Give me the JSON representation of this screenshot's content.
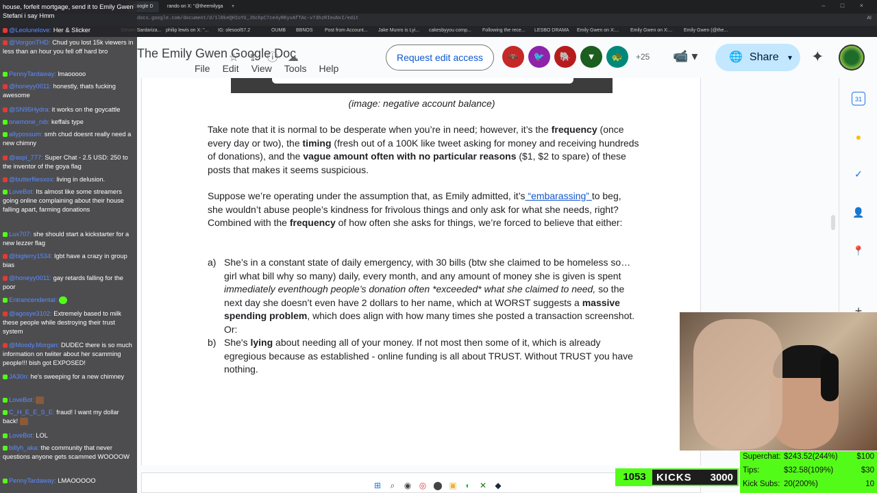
{
  "browser": {
    "tabs": [
      {
        "label": "Google D"
      },
      {
        "label": "rando on X: \"@theemilyga"
      },
      {
        "label": "+"
      }
    ],
    "url": "docs.google.com/document/d/1lRkeQHIoYU_J6chpC7ce4yRKyvAfTAc-v73hzRIeuNxI/edit",
    "address_right": "AI",
    "window_controls": "– □ ×",
    "bookmarks": [
      "Steven Sardariza...",
      "philip lewis on X: \"...",
      "IG: olesool57.2",
      "OUMB",
      "BBNOS",
      "Post from Account...",
      "Jake Munro is Lyi...",
      "cakesbyyou comp...",
      "Following the rece...",
      "LESBO DRAMA",
      "Emily Gwen on X:...",
      "Emily Gwen on X:...",
      "Emily Gwen (@the..."
    ]
  },
  "docs": {
    "title": "The Emily Gwen Google Doc",
    "icons": [
      "☆",
      "⇪",
      "ⓘ",
      "☁"
    ],
    "menu": [
      "File",
      "Edit",
      "View",
      "Tools",
      "Help"
    ],
    "request_access": "Request edit access",
    "avatars": [
      {
        "name": "bat-avatar-icon",
        "glyph": "🦇",
        "color": "#c62828"
      },
      {
        "name": "bird-avatar-icon",
        "glyph": "🐦",
        "color": "#8e24aa"
      },
      {
        "name": "elephant-avatar-icon",
        "glyph": "🐘",
        "color": "#b71c1c"
      },
      {
        "name": "narwhal-avatar-icon",
        "glyph": "▼",
        "color": "#1b5e20"
      },
      {
        "name": "turtle-avatar-icon",
        "glyph": "🐢",
        "color": "#00897b"
      }
    ],
    "avatar_count": "+25",
    "meet": "📹 ▾",
    "share": "Share",
    "share_globe": "🌐",
    "share_caret": "▾",
    "gemini": "✦"
  },
  "content": {
    "caption": "(image: negative account balance)",
    "p1": [
      {
        "t": "Take note that it is normal to be desperate when you’re in need; however, it’s the ",
        "s": ""
      },
      {
        "t": "frequency",
        "s": "b"
      },
      {
        "t": " (once every day or two), the ",
        "s": ""
      },
      {
        "t": "timing",
        "s": "b"
      },
      {
        "t": " (fresh out of a 100K like tweet asking for money and receiving hundreds of donations), and the ",
        "s": ""
      },
      {
        "t": "vague amount often with no particular reasons",
        "s": "b"
      },
      {
        "t": " ($1, $2 to spare) of these posts that makes it seems suspicious.",
        "s": ""
      }
    ],
    "p2": [
      {
        "t": "Suppose we’re operating under the assumption that, as Emily admitted, it’s",
        "s": ""
      },
      {
        "t": " “embarassing” ",
        "s": "link"
      },
      {
        "t": "to beg, she wouldn’t abuse people’s kindness for frivolous things and only ask for what she needs, right? Combined with the ",
        "s": ""
      },
      {
        "t": "frequency",
        "s": "b"
      },
      {
        "t": " of how often she asks for things, we’re forced to believe that either:",
        "s": ""
      }
    ],
    "list_a_marker": "a)",
    "list_a": [
      {
        "t": "She’s in a constant state of daily emergency, with 30 bills (btw she claimed to be homeless so… girl what bill why so many) daily, every month, and any amount of money she is given is spent ",
        "s": ""
      },
      {
        "t": "immediately eventhough people’s donation often *exceeded* what she claimed to need,",
        "s": "i"
      },
      {
        "t": " so the next day she doesn’t even have 2 dollars to her name, which at WORST suggests a ",
        "s": ""
      },
      {
        "t": "massive spending problem",
        "s": "b"
      },
      {
        "t": ", which does align with how many times she posted a transaction screenshot. Or:",
        "s": ""
      }
    ],
    "list_b_marker": "b)",
    "list_b": [
      {
        "t": "She's ",
        "s": ""
      },
      {
        "t": "lying",
        "s": "b"
      },
      {
        "t": " about needing all of your money. If not most then some of it, which is already egregious because as established - online funding is all about TRUST. Without TRUST you have nothing.",
        "s": ""
      }
    ]
  },
  "side_panel": [
    "31",
    "●",
    "✓",
    "👤",
    "📍",
    "+"
  ],
  "chat": [
    {
      "p": "",
      "u": "",
      "t": "house, forfeit mortgage, send it to Emily Gwen Stefani i say Hmm"
    },
    {
      "p": "yt",
      "u": "@Leolunelove:",
      "t": "Her & Slicker"
    },
    {
      "p": "yt",
      "u": "@VorgonTHD:",
      "t": "Chud you lost 15k viewers in less than an hour you fell off hard bro"
    },
    {
      "p": "k",
      "u": "PennyTardaway:",
      "t": "lmaooooo"
    },
    {
      "p": "yt",
      "u": "@honeyy0011:",
      "t": "honestly, thats fucking awesome"
    },
    {
      "p": "yt",
      "u": "@SN95Hydra:",
      "t": "it works on the goycattle"
    },
    {
      "p": "k",
      "u": "onemone_rxb:",
      "t": "keffals type"
    },
    {
      "p": "k",
      "u": "allypossum:",
      "t": "smh chud doesnt really need a new chimny"
    },
    {
      "p": "yt",
      "u": "@aspi_777:",
      "t": "Super Chat - 2.5 USD: 250 to the inventor of the goya flag"
    },
    {
      "p": "yt",
      "u": "@butterfliesxox:",
      "t": "living in delusion."
    },
    {
      "p": "k",
      "u": "LoveBot:",
      "t": "Its almost like some streamers going online complaining about their house falling apart, farming donations"
    },
    {
      "p": "k",
      "u": "Lux707:",
      "t": "she should start a kickstarter for a new lezzer flag"
    },
    {
      "p": "yt",
      "u": "@bigterry1534:",
      "t": "lgbt have a crazy in group bias"
    },
    {
      "p": "yt",
      "u": "@honeyy0011:",
      "t": "gay retards falling for the poor"
    },
    {
      "p": "k",
      "u": "Entrancendental:",
      "t": ""
    },
    {
      "p": "yt",
      "u": "@agosye3102:",
      "t": "Extremely based to milk these people while destroying their trust system"
    },
    {
      "p": "yt",
      "u": "@Moody.Morgan:",
      "t": "DUDEC there is so much information on twiiter about her scamming people!!! bish got EXPOSED!"
    },
    {
      "p": "k",
      "u": "JA30n:",
      "t": "he's sweeping for a new chimney"
    },
    {
      "p": "k",
      "u": "LoveBot:",
      "t": ""
    },
    {
      "p": "k",
      "u": "C_H_E_E_S_E:",
      "t": "fraud! I want my dollar back!"
    },
    {
      "p": "k",
      "u": "LoveBot:",
      "t": "LOL"
    },
    {
      "p": "k",
      "u": "billyh_aka:",
      "t": "the community that never questions anyone gets scammed WOOOOW"
    },
    {
      "p": "k",
      "u": "PennyTardaway:",
      "t": "LMAOOOOO"
    }
  ],
  "kicks": {
    "count": "1053",
    "label": "KICKS",
    "goal": "3000",
    "progress": 0.351
  },
  "stats": [
    {
      "label": "Superchat:",
      "value": "$243.52(244%)",
      "goal": "$100"
    },
    {
      "label": "Tips:",
      "value": "$32.58(109%)",
      "goal": "$30"
    },
    {
      "label": "Kick Subs:",
      "value": "20(200%)",
      "goal": "10"
    }
  ],
  "taskbar": [
    "⊞",
    "⌕",
    "◉",
    "◎",
    "⬤",
    "▣",
    "◐",
    "✕",
    "◆"
  ]
}
